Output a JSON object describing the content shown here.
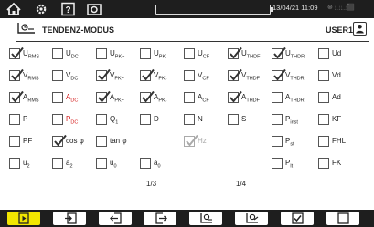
{
  "status_bar": {
    "datetime": "13/04/21 11:09",
    "extra": "⊛  ⬚⬚⬛"
  },
  "header": {
    "title": "TENDENZ-MODUS",
    "user": "USER1"
  },
  "checkboxes": [
    {
      "id": "urms",
      "label": "U",
      "sub": "RMS",
      "checked": true
    },
    {
      "id": "udc",
      "label": "U",
      "sub": "DC",
      "checked": false
    },
    {
      "id": "upk_plus",
      "label": "U",
      "sub": "PK+",
      "checked": false
    },
    {
      "id": "upk_minus",
      "label": "U",
      "sub": "PK-",
      "checked": false
    },
    {
      "id": "ucf",
      "label": "U",
      "sub": "CF",
      "checked": false
    },
    {
      "id": "uthdf",
      "label": "U",
      "sub": "THDF",
      "checked": true
    },
    {
      "id": "uthdr",
      "label": "U",
      "sub": "THDR",
      "checked": true
    },
    {
      "id": "ud",
      "label": "Ud",
      "sub": "",
      "checked": false
    },
    {
      "id": "vrms",
      "label": "V",
      "sub": "RMS",
      "checked": true
    },
    {
      "id": "vdc",
      "label": "V",
      "sub": "DC",
      "checked": false
    },
    {
      "id": "vpk_plus",
      "label": "V",
      "sub": "PK+",
      "checked": true
    },
    {
      "id": "vpk_minus",
      "label": "V",
      "sub": "PK-",
      "checked": true
    },
    {
      "id": "vcf",
      "label": "V",
      "sub": "CF",
      "checked": false
    },
    {
      "id": "vthdf",
      "label": "V",
      "sub": "THDF",
      "checked": true
    },
    {
      "id": "vthdr",
      "label": "V",
      "sub": "THDR",
      "checked": true
    },
    {
      "id": "vd",
      "label": "Vd",
      "sub": "",
      "checked": false
    },
    {
      "id": "arms",
      "label": "A",
      "sub": "RMS",
      "checked": true
    },
    {
      "id": "adc",
      "label": "A",
      "sub": "DC",
      "checked": false,
      "red": true
    },
    {
      "id": "apk_plus",
      "label": "A",
      "sub": "PK+",
      "checked": true
    },
    {
      "id": "apk_minus",
      "label": "A",
      "sub": "PK-",
      "checked": true
    },
    {
      "id": "acf",
      "label": "A",
      "sub": "CF",
      "checked": false
    },
    {
      "id": "athdf",
      "label": "A",
      "sub": "THDF",
      "checked": true
    },
    {
      "id": "athdr",
      "label": "A",
      "sub": "THDR",
      "checked": false
    },
    {
      "id": "ad",
      "label": "Ad",
      "sub": "",
      "checked": false
    },
    {
      "id": "p",
      "label": "P",
      "sub": "",
      "checked": false
    },
    {
      "id": "pdc",
      "label": "P",
      "sub": "DC",
      "checked": false,
      "red": true
    },
    {
      "id": "q1",
      "label": "Q",
      "sub": "1",
      "checked": false
    },
    {
      "id": "d",
      "label": "D",
      "sub": "",
      "checked": false
    },
    {
      "id": "n",
      "label": "N",
      "sub": "",
      "checked": false
    },
    {
      "id": "s",
      "label": "S",
      "sub": "",
      "checked": false
    },
    {
      "id": "pinst",
      "label": "P",
      "sub": "inst",
      "checked": false
    },
    {
      "id": "kf",
      "label": "KF",
      "sub": "",
      "checked": false
    },
    {
      "id": "pf",
      "label": "PF",
      "sub": "",
      "checked": false
    },
    {
      "id": "cosphi",
      "label": "cos φ",
      "sub": "",
      "checked": true
    },
    {
      "id": "tanphi",
      "label": "tan φ",
      "sub": "",
      "checked": false
    },
    {
      "id": "hz",
      "label": "Hz",
      "sub": "",
      "checked": true,
      "gray": true
    },
    {
      "id": "pst",
      "label": "P",
      "sub": "st",
      "checked": false
    },
    {
      "id": "fhl",
      "label": "FHL",
      "sub": "",
      "checked": false
    },
    {
      "id": "u2",
      "label": "u",
      "sub": "2",
      "checked": false
    },
    {
      "id": "a2",
      "label": "a",
      "sub": "2",
      "checked": false
    },
    {
      "id": "u0",
      "label": "u",
      "sub": "0",
      "checked": false
    },
    {
      "id": "a0",
      "label": "a",
      "sub": "0",
      "checked": false
    },
    {
      "id": "plt",
      "label": "P",
      "sub": "lt",
      "checked": false
    },
    {
      "id": "fk",
      "label": "FK",
      "sub": "",
      "checked": false
    }
  ],
  "pages": {
    "left": "1/3",
    "right": "1/4"
  },
  "accent_color": "#f2e600",
  "icons": [
    "home-icon",
    "settings-icon",
    "help-icon",
    "camera-icon",
    "user-icon",
    "play-icon",
    "enter-icon",
    "undo-icon",
    "redo-icon",
    "trend-icon",
    "trend-config-icon",
    "check-icon",
    "empty-icon"
  ]
}
